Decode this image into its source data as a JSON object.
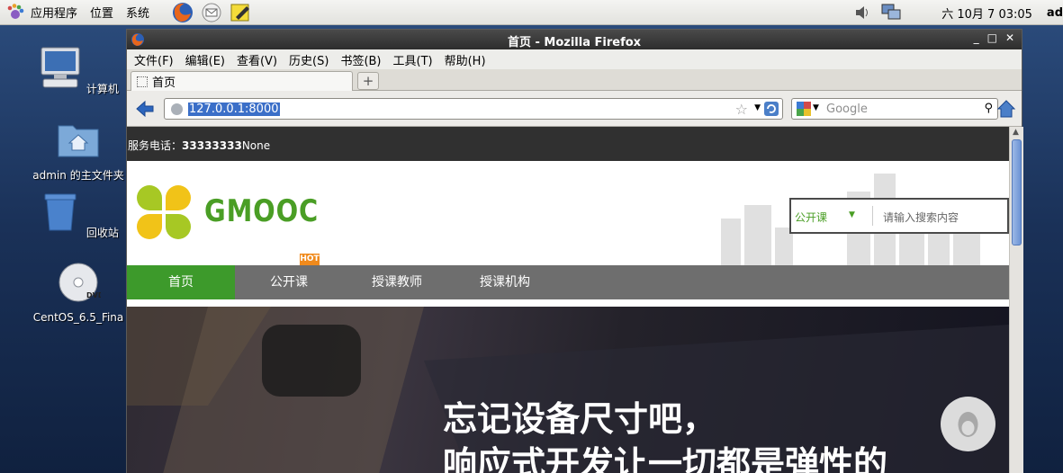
{
  "top_panel": {
    "menus": [
      "应用程序",
      "位置",
      "系统"
    ],
    "clock": "六 10月  7 03:05",
    "user": "ad"
  },
  "desktop": {
    "icons": [
      {
        "label": "计算机",
        "icon": "computer-icon"
      },
      {
        "label": "admin 的主文件夹",
        "icon": "home-folder-icon"
      },
      {
        "label": "回收站",
        "icon": "trash-icon"
      },
      {
        "label": "CentOS_6.5_Fina",
        "icon": "dvd-icon"
      }
    ]
  },
  "firefox": {
    "title": "首页 - Mozilla Firefox",
    "menu": [
      "文件(F)",
      "编辑(E)",
      "查看(V)",
      "历史(S)",
      "书签(B)",
      "工具(T)",
      "帮助(H)"
    ],
    "tab_title": "首页",
    "url": "127.0.0.1:8000",
    "search_placeholder": "Google"
  },
  "page": {
    "service_label": "服务电话：",
    "service_phone": "33333333",
    "service_suffix": "None",
    "brand": "GMOOC",
    "search_category": "公开课",
    "search_placeholder": "请输入搜索内容",
    "nav": [
      "首页",
      "公开课",
      "授课教师",
      "授课机构"
    ],
    "hot_badge": "HOT",
    "banner_line1": "忘记设备尺寸吧，",
    "banner_line2": "响应式开发让一切都是弹性的"
  },
  "colors": {
    "brand_green": "#4a9e25",
    "nav_active": "#3d9a2b",
    "hot_orange": "#f08a1c"
  }
}
